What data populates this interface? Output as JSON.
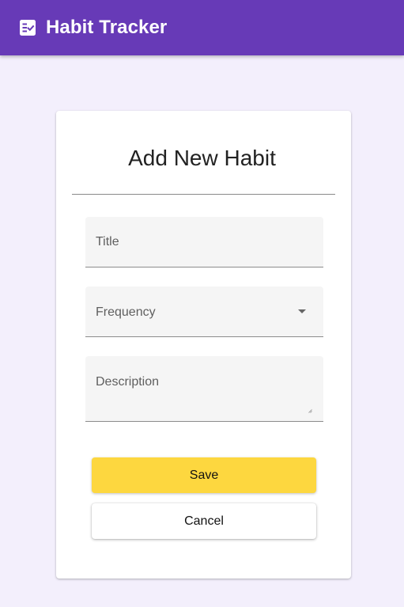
{
  "app": {
    "title": "Habit Tracker",
    "icon": "checklist-icon"
  },
  "form": {
    "heading": "Add New Habit",
    "fields": {
      "title": {
        "label": "Title",
        "value": ""
      },
      "frequency": {
        "label": "Frequency",
        "value": "",
        "icon": "dropdown-arrow-icon"
      },
      "description": {
        "label": "Description",
        "value": ""
      }
    },
    "buttons": {
      "save_label": "Save",
      "cancel_label": "Cancel"
    }
  },
  "colors": {
    "appbar": "#673ab7",
    "background": "#f3effc",
    "save_button": "#fdd73f",
    "field_background": "#f5f5f5"
  }
}
